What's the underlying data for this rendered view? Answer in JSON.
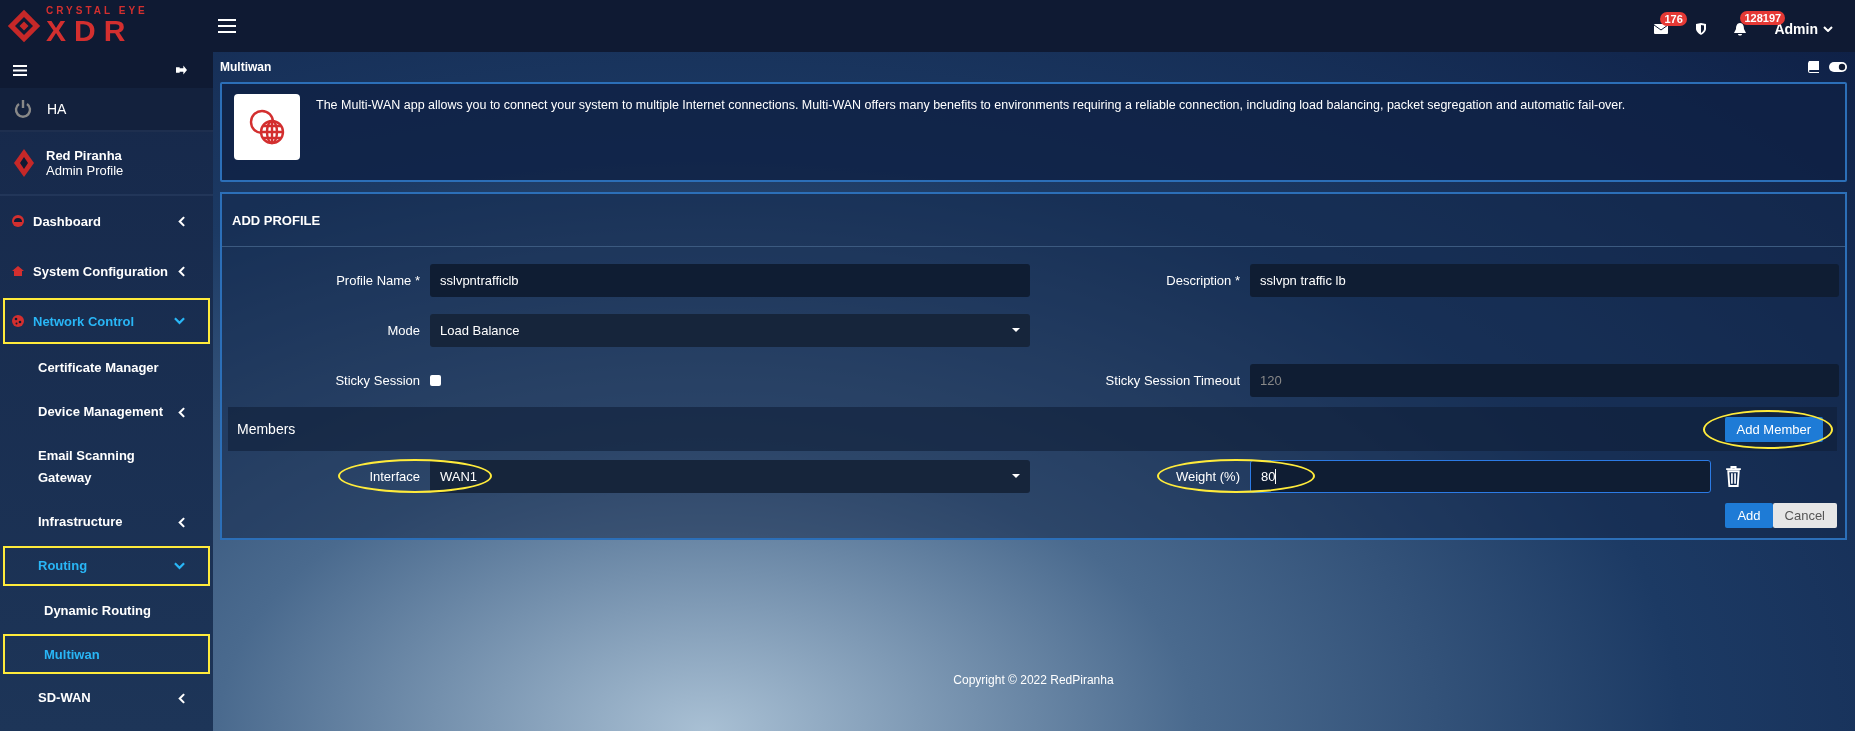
{
  "brand": {
    "tagline": "CRYSTAL EYE",
    "name": "XDR"
  },
  "header": {
    "mail_count": "176",
    "notification_count": "128197",
    "user": "Admin"
  },
  "sidebar": {
    "ha_label": "HA",
    "profile": {
      "name": "Red Piranha",
      "role": "Admin Profile"
    },
    "menu": [
      {
        "label": "Dashboard",
        "kind": "group",
        "expanded": false,
        "selected": false,
        "highlighted": false
      },
      {
        "label": "System Configuration",
        "kind": "group",
        "expanded": false,
        "selected": false,
        "highlighted": false
      },
      {
        "label": "Network Control",
        "kind": "group",
        "expanded": true,
        "selected": true,
        "highlighted": true,
        "children": [
          {
            "label": "Certificate Manager",
            "kind": "link",
            "selected": false,
            "highlighted": false
          },
          {
            "label": "Device Management",
            "kind": "group",
            "expanded": false,
            "selected": false,
            "highlighted": false
          },
          {
            "label": "Email Scanning Gateway",
            "kind": "link",
            "selected": false,
            "highlighted": false
          },
          {
            "label": "Infrastructure",
            "kind": "group",
            "expanded": false,
            "selected": false,
            "highlighted": false
          },
          {
            "label": "Routing",
            "kind": "group",
            "expanded": true,
            "selected": true,
            "highlighted": true,
            "children": [
              {
                "label": "Dynamic Routing",
                "kind": "link",
                "selected": false,
                "highlighted": false
              },
              {
                "label": "Multiwan",
                "kind": "link",
                "selected": true,
                "highlighted": true
              }
            ]
          },
          {
            "label": "SD-WAN",
            "kind": "group",
            "expanded": false,
            "selected": false,
            "highlighted": false
          }
        ]
      }
    ]
  },
  "page": {
    "title": "Multiwan",
    "description": "The Multi-WAN app allows you to connect your system to multiple Internet connections. Multi-WAN offers many benefits to environments requiring a reliable connection, including load balancing, packet segregation and automatic fail-over."
  },
  "form": {
    "title": "ADD PROFILE",
    "rows": [
      [
        {
          "kind": "text",
          "label": "Profile Name *",
          "value": "sslvpntrafficlb"
        },
        {
          "kind": "text",
          "label": "Description *",
          "value": "sslvpn traffic lb"
        }
      ],
      [
        {
          "kind": "select",
          "label": "Mode",
          "value": "Load Balance"
        }
      ],
      [
        {
          "kind": "checkbox",
          "label": "Sticky Session",
          "checked": false
        },
        {
          "kind": "text",
          "label": "Sticky Session Timeout",
          "placeholder": "120"
        }
      ]
    ],
    "members": {
      "title": "Members",
      "add_button": "Add Member",
      "add_button_circled": true,
      "rows": [
        {
          "interface_label": "Interface",
          "interface": "WAN1",
          "interface_circled": true,
          "weight_label": "Weight (%)",
          "weight": "80",
          "weight_circled": true
        }
      ]
    },
    "buttons": [
      "Add",
      "Cancel"
    ]
  },
  "footer": "Copyright © 2022 RedPiranha"
}
